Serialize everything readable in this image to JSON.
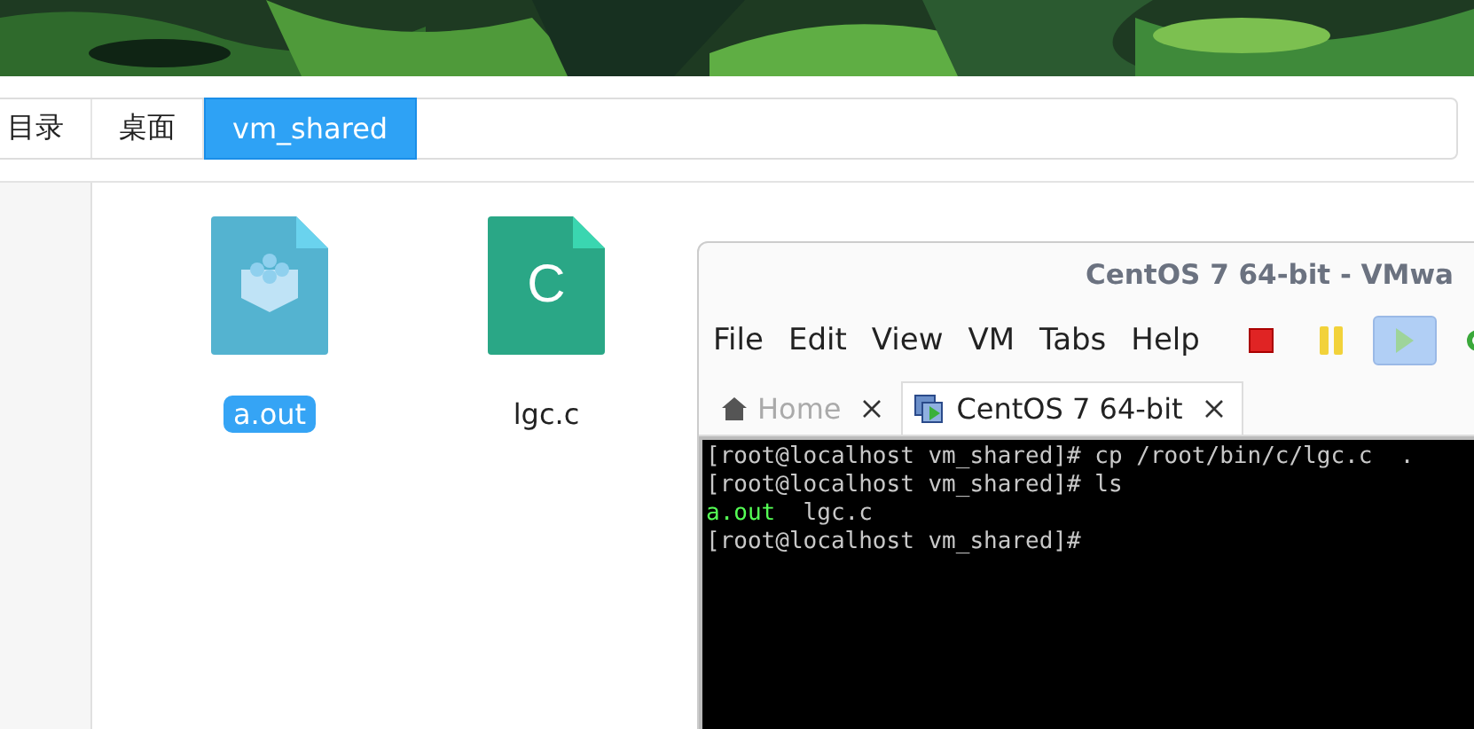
{
  "breadcrumb": [
    {
      "label": "目录",
      "selected": false
    },
    {
      "label": "桌面",
      "selected": false
    },
    {
      "label": "vm_shared",
      "selected": true
    }
  ],
  "files": [
    {
      "name": "a.out",
      "kind": "binary",
      "selected": true
    },
    {
      "name": "lgc.c",
      "kind": "source",
      "icon_text": "C",
      "selected": false
    }
  ],
  "vm_window": {
    "title": "CentOS 7 64-bit - VMwa",
    "menu": [
      "File",
      "Edit",
      "View",
      "VM",
      "Tabs",
      "Help"
    ],
    "toolbar": [
      {
        "kind": "stop",
        "selected": false
      },
      {
        "kind": "pause",
        "selected": false
      },
      {
        "kind": "play",
        "selected": true
      },
      {
        "kind": "refresh",
        "selected": false
      }
    ],
    "tabs": [
      {
        "label": "Home",
        "kind": "home",
        "selected": false
      },
      {
        "label": "CentOS 7 64-bit",
        "kind": "vm",
        "selected": true
      }
    ],
    "terminal": [
      [
        {
          "text": "[root@localhost vm_shared]# cp /root/bin/c/lgc.c  .",
          "color": "#c8c8c8"
        }
      ],
      [
        {
          "text": "[root@localhost vm_shared]# ls",
          "color": "#c8c8c8"
        }
      ],
      [
        {
          "text": "a.out",
          "color": "#55ff55"
        },
        {
          "text": "  lgc.c",
          "color": "#c8c8c8"
        }
      ],
      [
        {
          "text": "[root@localhost vm_shared]#",
          "color": "#c8c8c8"
        }
      ]
    ]
  }
}
